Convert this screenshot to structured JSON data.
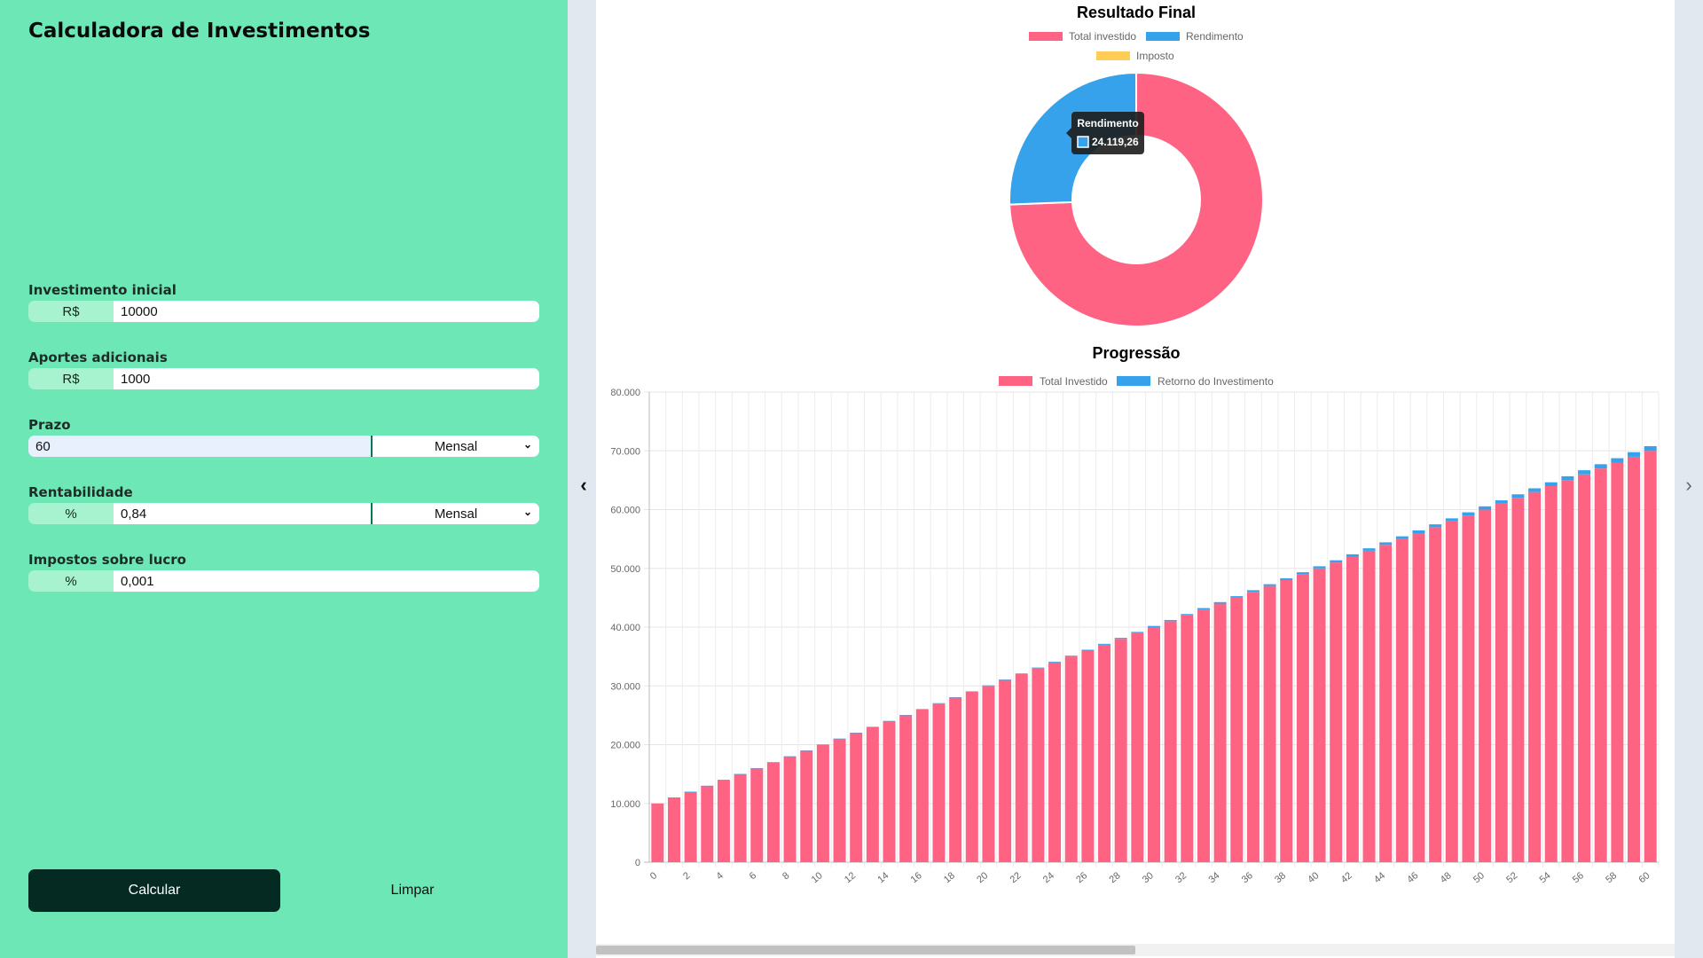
{
  "app": {
    "title": "Calculadora de Investimentos"
  },
  "form": {
    "initial": {
      "label": "Investimento inicial",
      "prefix": "R$",
      "value": "10000"
    },
    "monthly": {
      "label": "Aportes adicionais",
      "prefix": "R$",
      "value": "1000"
    },
    "term": {
      "label": "Prazo",
      "value": "60",
      "period": "Mensal"
    },
    "rate": {
      "label": "Rentabilidade",
      "prefix": "%",
      "value": "0,84",
      "period": "Mensal"
    },
    "tax": {
      "label": "Impostos sobre lucro",
      "prefix": "%",
      "value": "0,001"
    },
    "calc_label": "Calcular",
    "clear_label": "Limpar"
  },
  "nav": {
    "left_icon": "chevron-left-icon",
    "right_icon": "chevron-right-icon"
  },
  "colors": {
    "invested": "#ff6384",
    "return": "#36a2eb",
    "tax": "#ffcd56",
    "sidebar": "#6ee7b7",
    "button": "#042a22"
  },
  "chart_data": [
    {
      "type": "doughnut",
      "title": "Resultado Final",
      "legend_position": "top",
      "labels": [
        "Total investido",
        "Rendimento",
        "Imposto"
      ],
      "values": [
        70000,
        24119.26,
        0
      ],
      "tooltip": {
        "title": "Rendimento",
        "value": "24.119,26"
      }
    },
    {
      "type": "bar",
      "stacked": true,
      "title": "Progressão",
      "legend_position": "top",
      "x_start": 0,
      "x_end": 60,
      "x_tick_step": 2,
      "ylim": [
        0,
        80000
      ],
      "y_ticks": [
        "0",
        "10.000",
        "20.000",
        "30.000",
        "40.000",
        "50.000",
        "60.000",
        "70.000",
        "80.000"
      ],
      "grid": true,
      "series": [
        {
          "name": "Total Investido",
          "start": 10000,
          "step": 1000
        },
        {
          "name": "Retorno do Investimento",
          "start": 0,
          "end": 800
        }
      ]
    }
  ]
}
